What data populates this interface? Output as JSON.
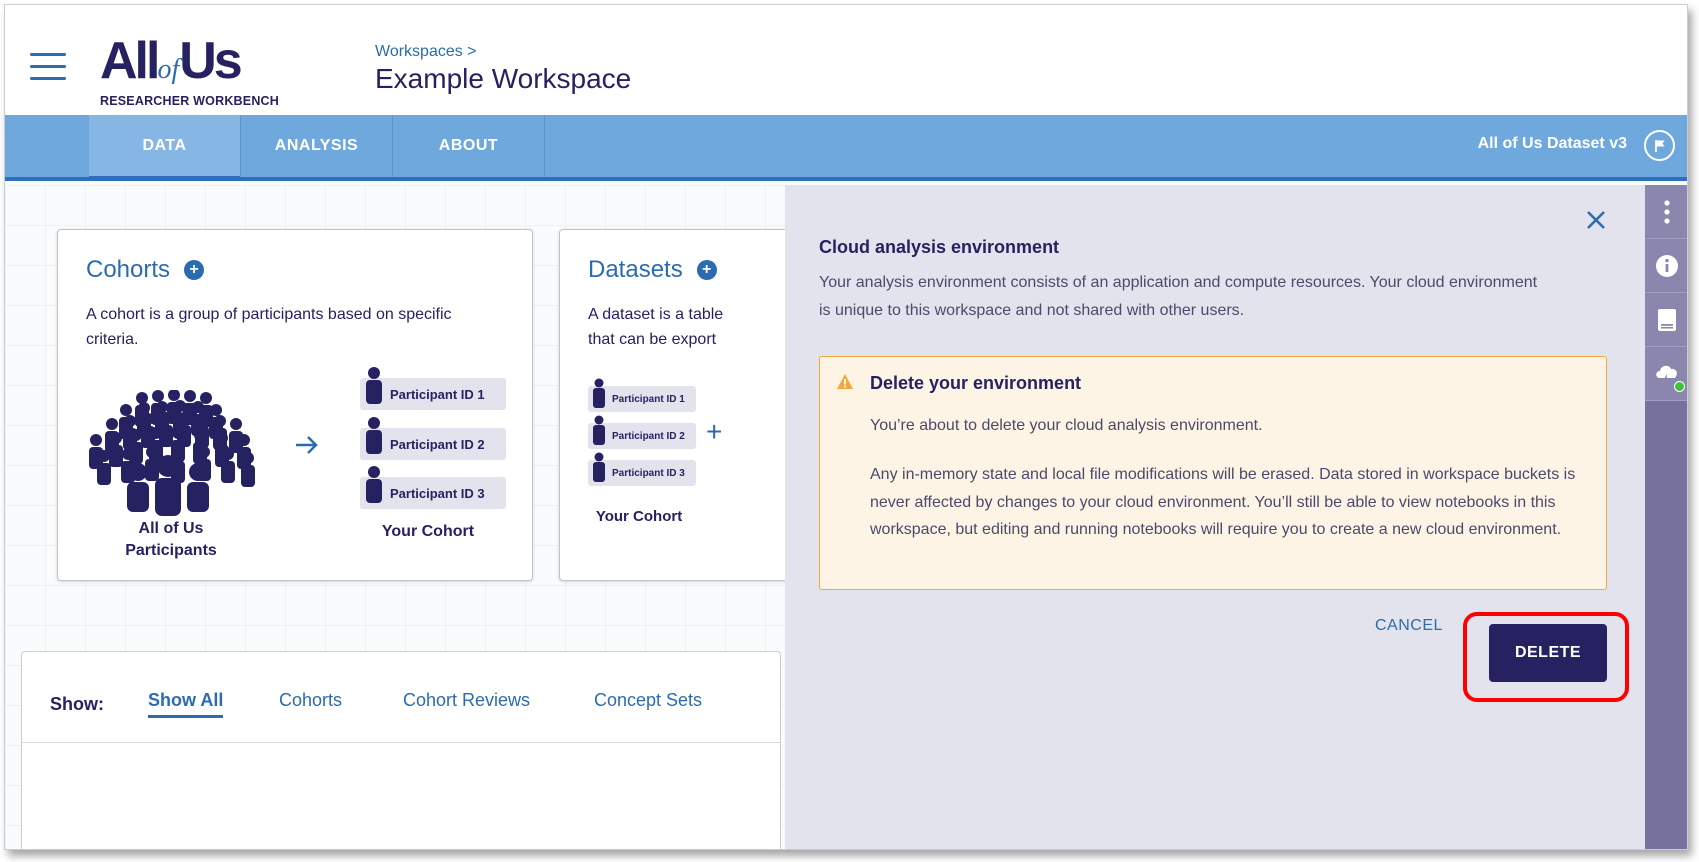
{
  "header": {
    "logo": {
      "main": "All",
      "of": "of",
      "main2": "Us",
      "sub": "RESEARCHER WORKBENCH"
    },
    "breadcrumb": "Workspaces >",
    "title": "Example Workspace"
  },
  "nav": {
    "tabs": [
      {
        "label": "DATA",
        "active": true
      },
      {
        "label": "ANALYSIS",
        "active": false
      },
      {
        "label": "ABOUT",
        "active": false
      }
    ],
    "dataset": "All of Us Dataset v3",
    "flag_icon": "flag-icon"
  },
  "cohorts_card": {
    "title": "Cohorts",
    "description": "A cohort is a group of participants based on specific criteria.",
    "participants": [
      "Participant ID 1",
      "Participant ID 2",
      "Participant ID 3"
    ],
    "left_caption_line1": "All of Us",
    "left_caption_line2": "Participants",
    "right_caption": "Your Cohort"
  },
  "datasets_card": {
    "title": "Datasets",
    "description_line1": "A dataset is a table",
    "description_line2": "that can be export",
    "participants": [
      "Participant ID 1",
      "Participant ID 2",
      "Participant ID 3"
    ],
    "caption": "Your Cohort",
    "plus": "+"
  },
  "filters": {
    "label": "Show:",
    "items": [
      "Show All",
      "Cohorts",
      "Cohort Reviews",
      "Concept Sets"
    ],
    "active": "Show All"
  },
  "drawer": {
    "title": "Cloud analysis environment",
    "description": "Your analysis environment consists of an application and compute resources. Your cloud environment is unique to this workspace and not shared with other users.",
    "warning": {
      "title": "Delete your environment",
      "p1": "You’re about to delete your cloud analysis environment.",
      "p2": "Any in-memory state and local file modifications will be erased.  Data stored in workspace buckets is never affected by changes to your cloud  environment. You’ll still be able to view notebooks in this workspace, but  editing and running notebooks will require you to create a new cloud environment."
    },
    "cancel_label": "CANCEL",
    "delete_label": "DELETE",
    "close_icon": "close-icon"
  },
  "icon_strip": [
    "more-vertical-icon",
    "info-icon",
    "book-icon",
    "cloud-lightning-icon"
  ],
  "colors": {
    "navy": "#262262",
    "blue": "#2b6cb0",
    "navbar": "#6fa8dc",
    "drawer_bg": "#e3e3ee",
    "warning_border": "#f2a83a",
    "highlight": "#ff0000",
    "status_green": "#3fc33f"
  }
}
